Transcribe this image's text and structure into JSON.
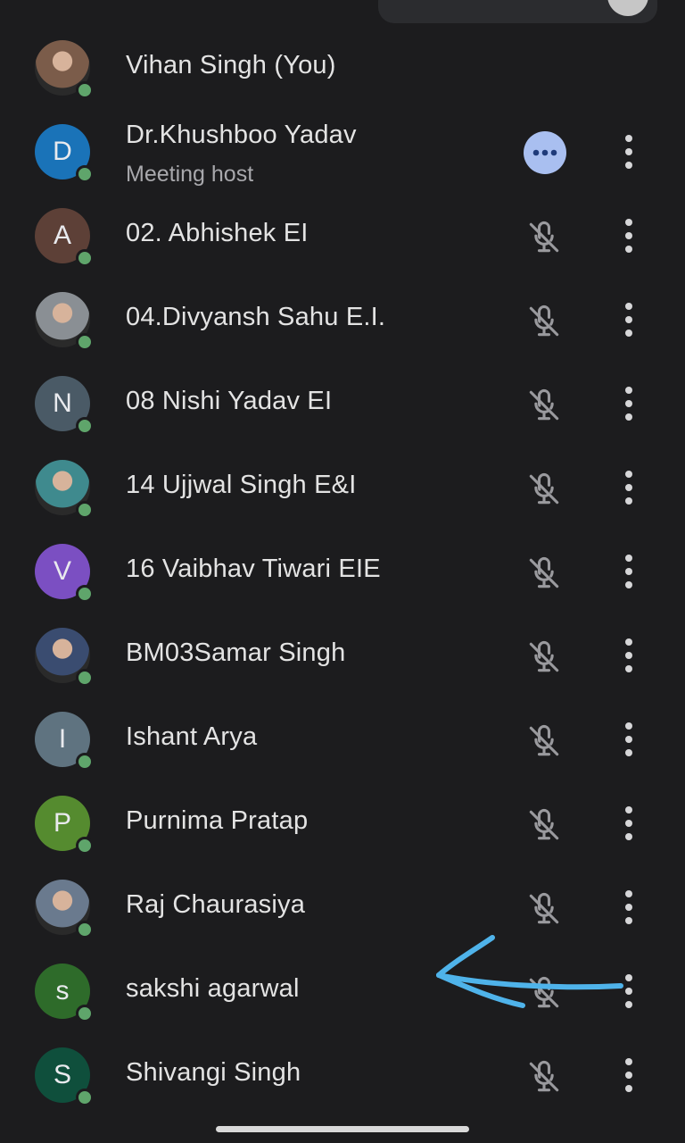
{
  "participants": [
    {
      "name": "Vihan Singh (You)",
      "avatar": {
        "type": "photo",
        "letter": "",
        "color": "#7b5c4a"
      },
      "online": true,
      "action": "none"
    },
    {
      "name": "Dr.Khushboo Yadav",
      "subtitle": "Meeting host",
      "avatar": {
        "type": "letter",
        "letter": "D",
        "color": "#1a73b8"
      },
      "online": true,
      "action": "more"
    },
    {
      "name": "02. Abhishek EI",
      "avatar": {
        "type": "letter",
        "letter": "A",
        "color": "#5d4037"
      },
      "online": true,
      "action": "muted"
    },
    {
      "name": "04.Divyansh Sahu E.I.",
      "avatar": {
        "type": "photo",
        "letter": "",
        "color": "#8a8f94"
      },
      "online": true,
      "action": "muted"
    },
    {
      "name": "08 Nishi Yadav EI",
      "avatar": {
        "type": "letter",
        "letter": "N",
        "color": "#4a5a66"
      },
      "online": true,
      "action": "muted"
    },
    {
      "name": "14 Ujjwal Singh E&I",
      "avatar": {
        "type": "photo",
        "letter": "",
        "color": "#3f8a8e"
      },
      "online": true,
      "action": "muted"
    },
    {
      "name": "16 Vaibhav Tiwari EIE",
      "avatar": {
        "type": "letter",
        "letter": "V",
        "color": "#7b4fc2"
      },
      "online": true,
      "action": "muted"
    },
    {
      "name": "BM03Samar Singh",
      "avatar": {
        "type": "photo",
        "letter": "",
        "color": "#3a4c70"
      },
      "online": true,
      "action": "muted"
    },
    {
      "name": "Ishant Arya",
      "avatar": {
        "type": "letter",
        "letter": "I",
        "color": "#5f7380"
      },
      "online": true,
      "action": "muted"
    },
    {
      "name": "Purnima Pratap",
      "avatar": {
        "type": "letter",
        "letter": "P",
        "color": "#558b2f"
      },
      "online": true,
      "action": "muted"
    },
    {
      "name": "Raj Chaurasiya",
      "avatar": {
        "type": "photo",
        "letter": "",
        "color": "#6a7a8e"
      },
      "online": true,
      "action": "muted"
    },
    {
      "name": "sakshi agarwal",
      "avatar": {
        "type": "letter",
        "letter": "s",
        "color": "#2e6b2a"
      },
      "online": true,
      "action": "muted"
    },
    {
      "name": "Shivangi Singh",
      "avatar": {
        "type": "letter",
        "letter": "S",
        "color": "#0f4f3c"
      },
      "online": true,
      "action": "muted"
    }
  ],
  "icons": {
    "mic": "mic-off-icon",
    "menu": "more-vert-icon",
    "more": "more-horiz-icon",
    "annotation": "arrow-annotation"
  },
  "colors": {
    "background": "#1c1c1e",
    "presence": "#5fa56b",
    "more_button": "#a9bff0",
    "annotation": "#4fb3ea"
  }
}
